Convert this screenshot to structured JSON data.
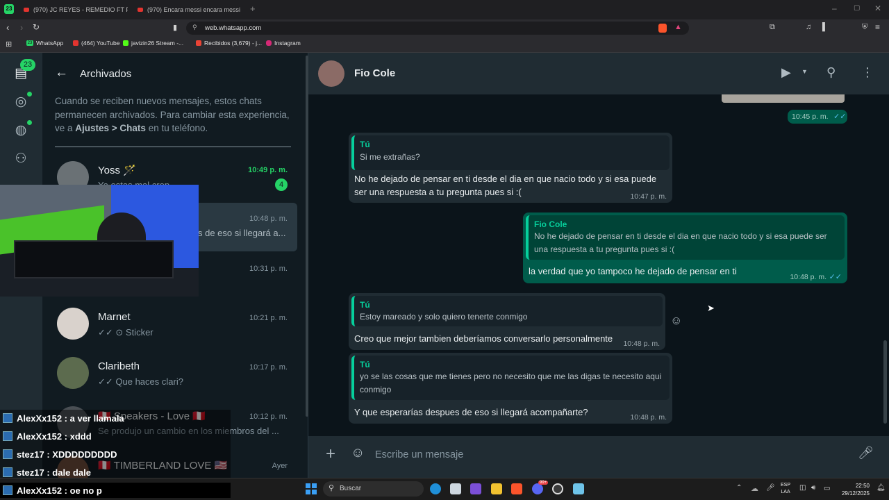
{
  "browser": {
    "tab_badge": "23",
    "tabs": [
      {
        "label": "(970) JC REYES - REMEDIO FT PIRLO"
      },
      {
        "label": "(970) Encara messi encara messi enca"
      }
    ],
    "url": "web.whatsapp.com",
    "bookmarks": [
      {
        "label": "WhatsApp",
        "badge": "23"
      },
      {
        "label": "(464) YouTube"
      },
      {
        "label": "javizin26 Stream -..."
      },
      {
        "label": "Recibidos (3,679) - j..."
      },
      {
        "label": "Instagram"
      }
    ]
  },
  "rail": {
    "chats_badge": "23"
  },
  "archive": {
    "title": "Archivados",
    "notice_pre": "Cuando se reciben nuevos mensajes, estos chats permanecen archivados. Para cambiar esta experiencia, ve a ",
    "notice_bold": "Ajustes > Chats",
    "notice_post": " en tu teléfono.",
    "chats": [
      {
        "name": "Yoss 🪄",
        "preview": "Ya estas mal crep...",
        "time": "10:49 p. m.",
        "unread": "4"
      },
      {
        "name": "",
        "preview": "s de eso si llegará a...",
        "time": "10:48 p. m."
      },
      {
        "name": "",
        "preview": "",
        "time": "10:31 p. m."
      },
      {
        "name": "Marnet",
        "preview": "✓✓ ⊙ Sticker",
        "time": "10:21 p. m."
      },
      {
        "name": "Claribeth",
        "preview": "✓✓ Que haces clari?",
        "time": "10:17 p. m."
      },
      {
        "name": "🇵🇪 Speakers - Love 🇵🇪",
        "preview": "Se produjo un cambio en los miembros del ...",
        "time": "10:12 p. m."
      },
      {
        "name": "🇵🇪 TIMBERLAND LOVE 🇺🇸",
        "preview": "",
        "time": "Ayer"
      }
    ]
  },
  "chat": {
    "contact": "Fio Cole",
    "messages": [
      {
        "time": "10:45 p. m."
      },
      {
        "quote_name": "Tú",
        "quote_text": "Si me extrañas?",
        "text": "No he dejado de pensar en ti desde el dia en que nacio todo y si esa puede ser una respuesta a tu pregunta pues si :(",
        "time": "10:47 p. m."
      },
      {
        "quote_name": "Fio Cole",
        "quote_text": "No he dejado de pensar en ti desde el dia en que nacio todo y si esa puede ser una respuesta a tu pregunta pues si :(",
        "text": "la verdad que yo tampoco he dejado de pensar en ti",
        "time": "10:48 p. m."
      },
      {
        "quote_name": "Tú",
        "quote_text": "Estoy mareado y solo quiero tenerte conmigo",
        "text": "Creo que mejor tambien deberíamos conversarlo personalmente",
        "time": "10:48 p. m."
      },
      {
        "quote_name": "Tú",
        "quote_text": "yo se las cosas que me tienes pero no necesito que me las digas te necesito aqui conmigo",
        "text": "Y que esperarías despues de eso si llegará acompañarte?",
        "time": "10:48 p. m."
      }
    ],
    "composer_placeholder": "Escribe un mensaje"
  },
  "stream_chat": [
    {
      "text": "AlexXx152 : a ver llamala"
    },
    {
      "text": "AlexXx152 : xddd"
    },
    {
      "text": "stez17 : XDDDDDDDDD"
    },
    {
      "text": "stez17 : dale dale"
    },
    {
      "text": "AlexXx152 : oe no p"
    }
  ],
  "taskbar": {
    "search": "Buscar",
    "lang": "ESP",
    "lang2": "LAA",
    "time": "22:50",
    "date": "29/12/2025",
    "discord_badge": "99+"
  },
  "colors": {
    "accent": "#00a884",
    "quote_bar": "#06cf9c",
    "outgoing": "#005c4b",
    "incoming": "#202c33",
    "unread_badge": "#25d366"
  }
}
